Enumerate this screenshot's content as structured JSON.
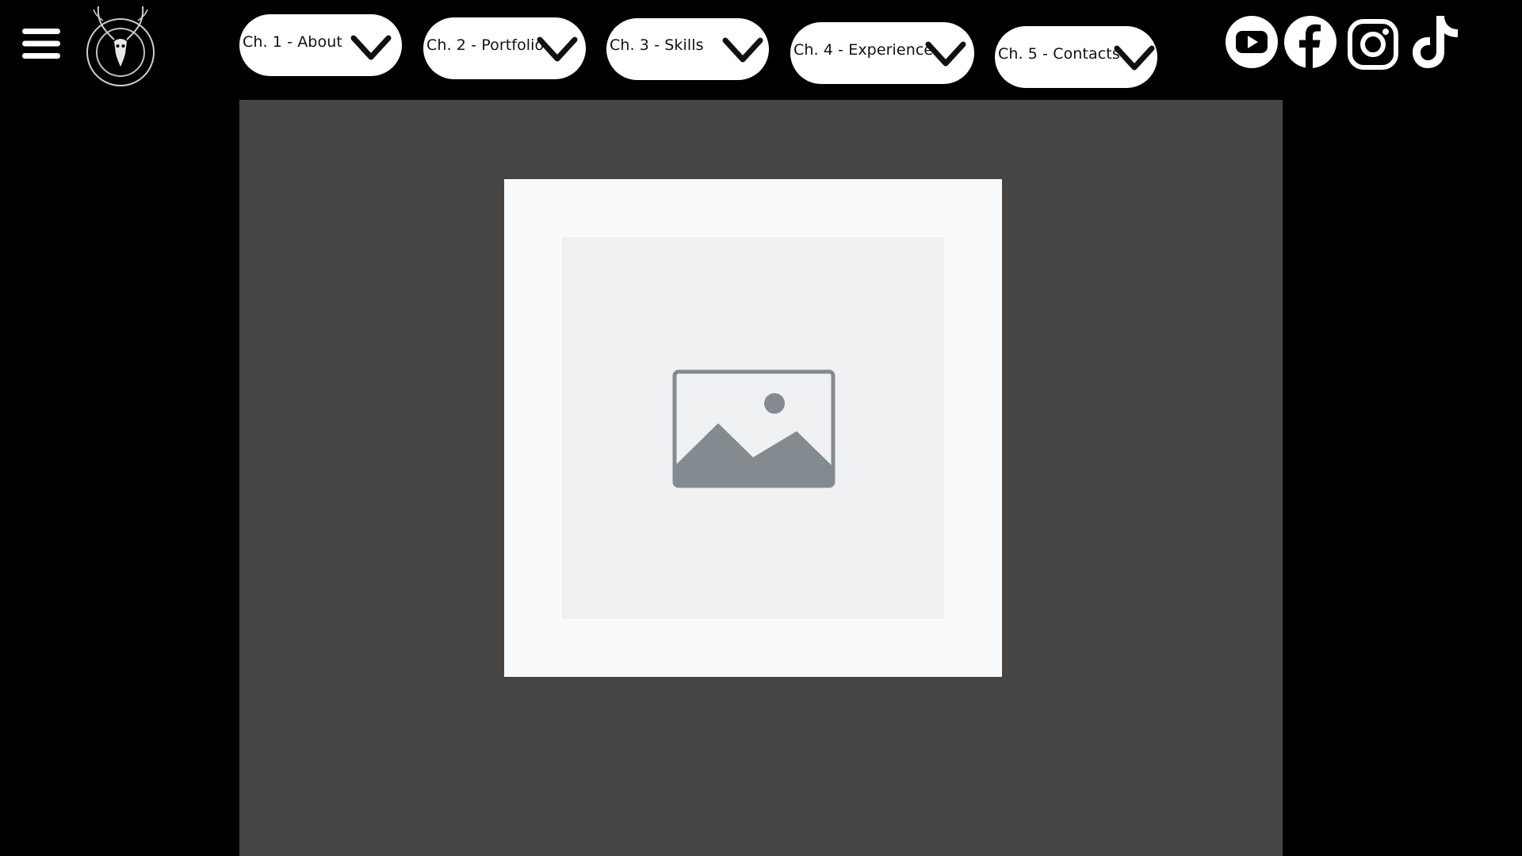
{
  "header": {
    "menu_icon": "hamburger-menu-icon",
    "logo_icon": "antler-skull-logo-icon"
  },
  "nav": {
    "items": [
      {
        "label": "Ch. 1 - About",
        "icon": "chevron-down-icon"
      },
      {
        "label": "Ch. 2 - Portfolio",
        "icon": "chevron-down-icon"
      },
      {
        "label": "Ch. 3 - Skills",
        "icon": "chevron-down-icon"
      },
      {
        "label": "Ch. 4 - Experience",
        "icon": "chevron-down-icon"
      },
      {
        "label": "Ch. 5 - Contacts",
        "icon": "chevron-down-icon"
      }
    ]
  },
  "social": {
    "items": [
      {
        "icon": "youtube-icon"
      },
      {
        "icon": "facebook-icon"
      },
      {
        "icon": "instagram-icon"
      },
      {
        "icon": "tiktok-icon"
      }
    ]
  },
  "main": {
    "image_placeholder_icon": "image-placeholder-icon"
  },
  "colors": {
    "background": "#000000",
    "panel": "#454545",
    "frame": "#f9fafb",
    "placeholder_bg": "#f0f1f2",
    "placeholder_icon": "#838b91",
    "pill": "#ffffff",
    "text": "#111111"
  }
}
